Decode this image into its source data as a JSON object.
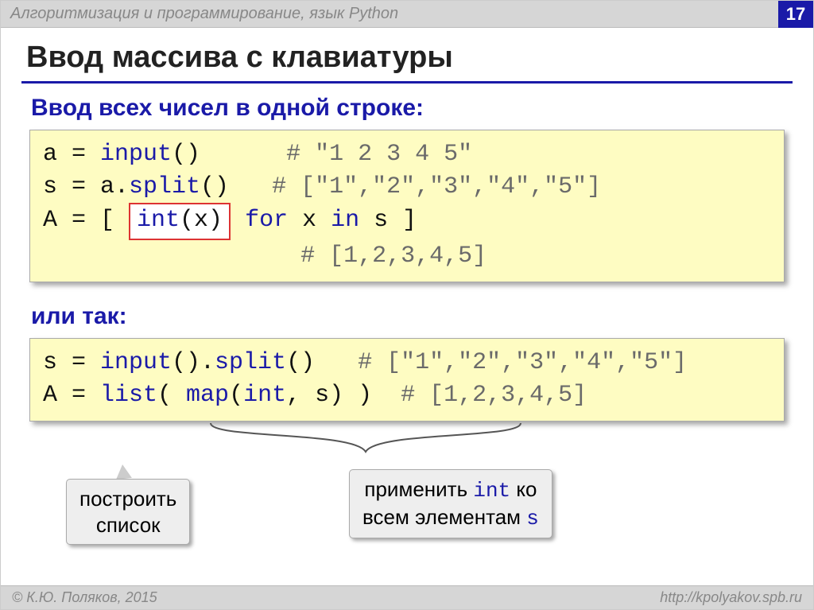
{
  "header": {
    "title": "Алгоритмизация и программирование, язык Python",
    "page": "17"
  },
  "title": "Ввод массива с клавиатуры",
  "subtitle": "Ввод всех чисел в одной строке:",
  "code1": {
    "l1_a": "a = ",
    "l1_kw": "input",
    "l1_b": "()      ",
    "l1_cmt": "# \"1 2 3 4 5\"",
    "l2_a": "s = a.",
    "l2_kw": "split",
    "l2_b": "()   ",
    "l2_cmt": "# [\"1\",\"2\",\"3\",\"4\",\"5\"]",
    "l3_a": "A = [ ",
    "l3_hl1": "int",
    "l3_hl2": "(x)",
    "l3_b": " ",
    "l3_kw": "for",
    "l3_c": " x ",
    "l3_kw2": "in",
    "l3_d": " s ]",
    "l4_pad": "                  ",
    "l4_cmt": "# [1,2,3,4,5]"
  },
  "or_label": "или так:",
  "code2": {
    "l1_a": "s = ",
    "l1_kw1": "input",
    "l1_b": "().",
    "l1_kw2": "split",
    "l1_c": "()   ",
    "l1_cmt": "# [\"1\",\"2\",\"3\",\"4\",\"5\"]",
    "l2_a": "A = ",
    "l2_kw1": "list",
    "l2_b": "( ",
    "l2_kw2": "map",
    "l2_c": "(",
    "l2_kw3": "int",
    "l2_d": ", s) )  ",
    "l2_cmt": "# [1,2,3,4,5]"
  },
  "callout1": {
    "line1": "построить",
    "line2": "список"
  },
  "callout2": {
    "t1": "применить ",
    "t_mono": "int",
    "t2": " ко",
    "t3": "всем элементам ",
    "t_mono2": "s"
  },
  "footer": {
    "left": "© К.Ю. Поляков, 2015",
    "right": "http://kpolyakov.spb.ru"
  }
}
